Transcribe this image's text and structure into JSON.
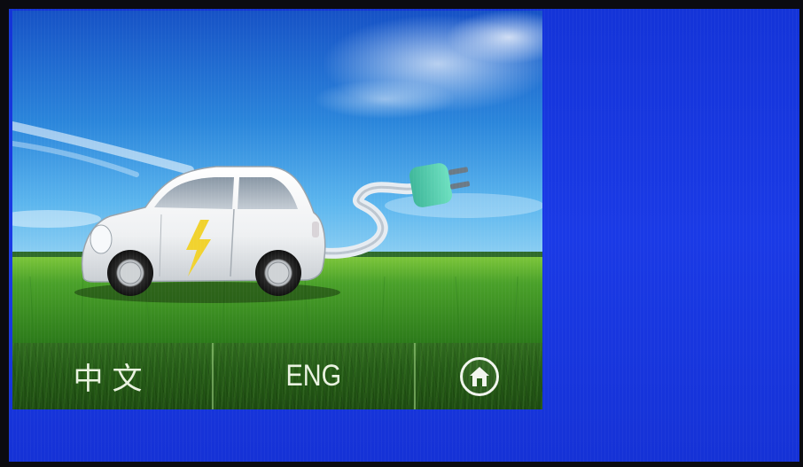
{
  "screen": {
    "background_color": "#1a3ae6"
  },
  "banner": {
    "illustration": "electric-car-with-charging-plug",
    "sky_color": "#2a7ed8",
    "grass_color": "#4aa12a"
  },
  "language_bar": {
    "chinese_label": "中文",
    "english_label": "ENG",
    "home_icon": "home-icon"
  }
}
